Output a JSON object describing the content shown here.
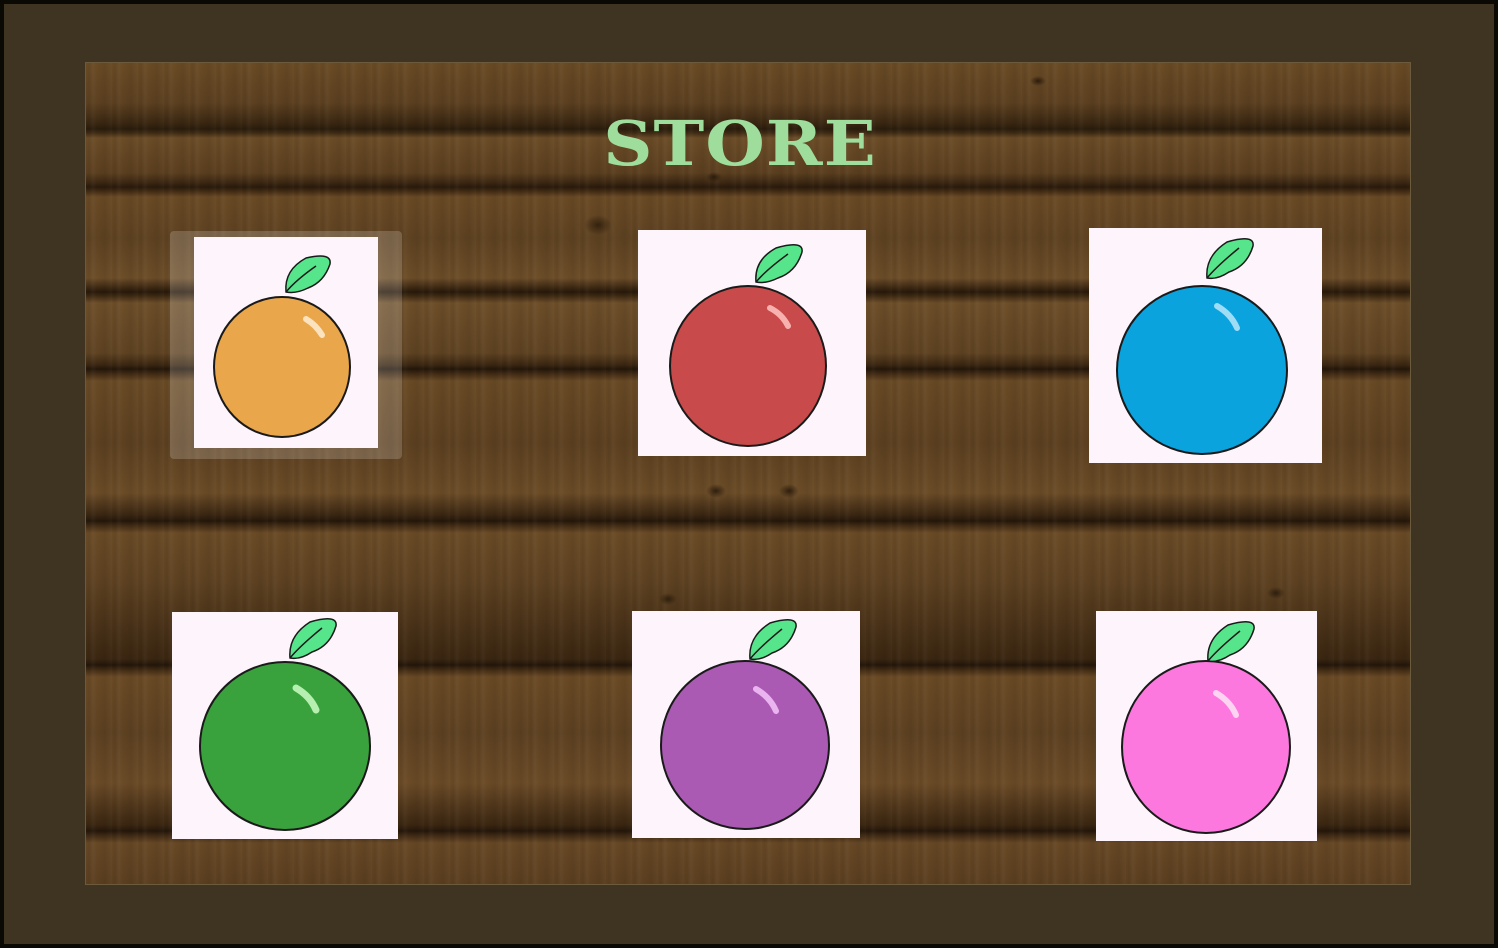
{
  "store": {
    "title": "STORE"
  },
  "items": [
    {
      "fruit_icon": "orange-fruit-icon",
      "color": "#eaa64a",
      "highlight": "#fbe3c0",
      "selected": true
    },
    {
      "fruit_icon": "red-fruit-icon",
      "color": "#c84a4a",
      "highlight": "#f7b2b0",
      "selected": false
    },
    {
      "fruit_icon": "blue-fruit-icon",
      "color": "#0aa3de",
      "highlight": "#9fdcf5",
      "selected": false
    },
    {
      "fruit_icon": "green-fruit-icon",
      "color": "#3aa23d",
      "highlight": "#b6f0b0",
      "selected": false
    },
    {
      "fruit_icon": "purple-fruit-icon",
      "color": "#aa5ab2",
      "highlight": "#eab4f0",
      "selected": false
    },
    {
      "fruit_icon": "pink-fruit-icon",
      "color": "#fd78de",
      "highlight": "#fcd4f1",
      "selected": false
    }
  ],
  "leaf_color": "#57e58c"
}
